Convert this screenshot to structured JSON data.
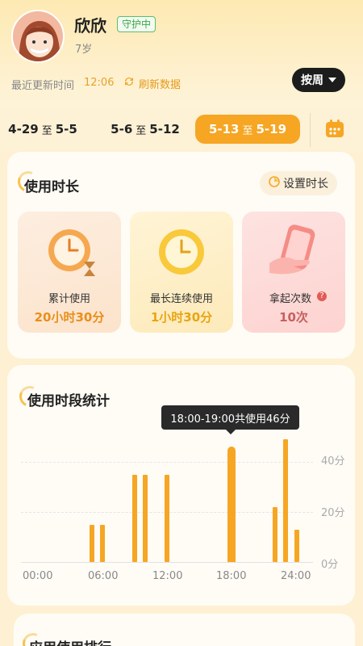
{
  "profile": {
    "name": "欣欣",
    "status_badge": "守护中",
    "age": "7岁"
  },
  "update": {
    "label": "最近更新时间",
    "time": "12:06",
    "refresh_label": "刷新数据"
  },
  "period_button": "按周",
  "week_tabs": [
    {
      "start": "4-29",
      "sep": "至",
      "end": "5-5",
      "active": false
    },
    {
      "start": "5-6",
      "sep": "至",
      "end": "5-12",
      "active": false
    },
    {
      "start": "5-13",
      "sep": "至",
      "end": "5-19",
      "active": true
    }
  ],
  "usage": {
    "title": "使用时长",
    "set_time_label": "设置时长",
    "stats": [
      {
        "label": "累计使用",
        "value": "20小时30分",
        "icon": "clock-hourglass-icon"
      },
      {
        "label": "最长连续使用",
        "value": "1小时30分",
        "icon": "clock-icon"
      },
      {
        "label": "拿起次数",
        "value": "10次",
        "icon": "hand-phone-icon",
        "help": "?"
      }
    ]
  },
  "timeline": {
    "title": "使用时段统计",
    "tooltip": "18:00-19:00共使用46分",
    "y_ticks": [
      "40分",
      "20分",
      "0分"
    ],
    "x_ticks": [
      "00:00",
      "06:00",
      "12:00",
      "18:00",
      "24:00"
    ]
  },
  "chart_data": {
    "type": "bar",
    "x_unit": "hour",
    "y_unit": "分",
    "ylim": [
      0,
      48
    ],
    "xlim": [
      0,
      24
    ],
    "bars": [
      {
        "hour": 5.5,
        "value": 15
      },
      {
        "hour": 6.5,
        "value": 15
      },
      {
        "hour": 9.5,
        "value": 35
      },
      {
        "hour": 10.5,
        "value": 35
      },
      {
        "hour": 12.5,
        "value": 35
      },
      {
        "hour": 18.5,
        "value": 46
      },
      {
        "hour": 22.5,
        "value": 22
      },
      {
        "hour": 23.5,
        "value": 49
      },
      {
        "hour": 24.5,
        "value": 13
      }
    ],
    "grid": true,
    "accent": "#f6a623"
  },
  "next_section": {
    "title": "应用使用排行"
  },
  "colors": {
    "accent": "#f6a623",
    "badge_green": "#3aa84b",
    "dark": "#1c1c1c"
  }
}
